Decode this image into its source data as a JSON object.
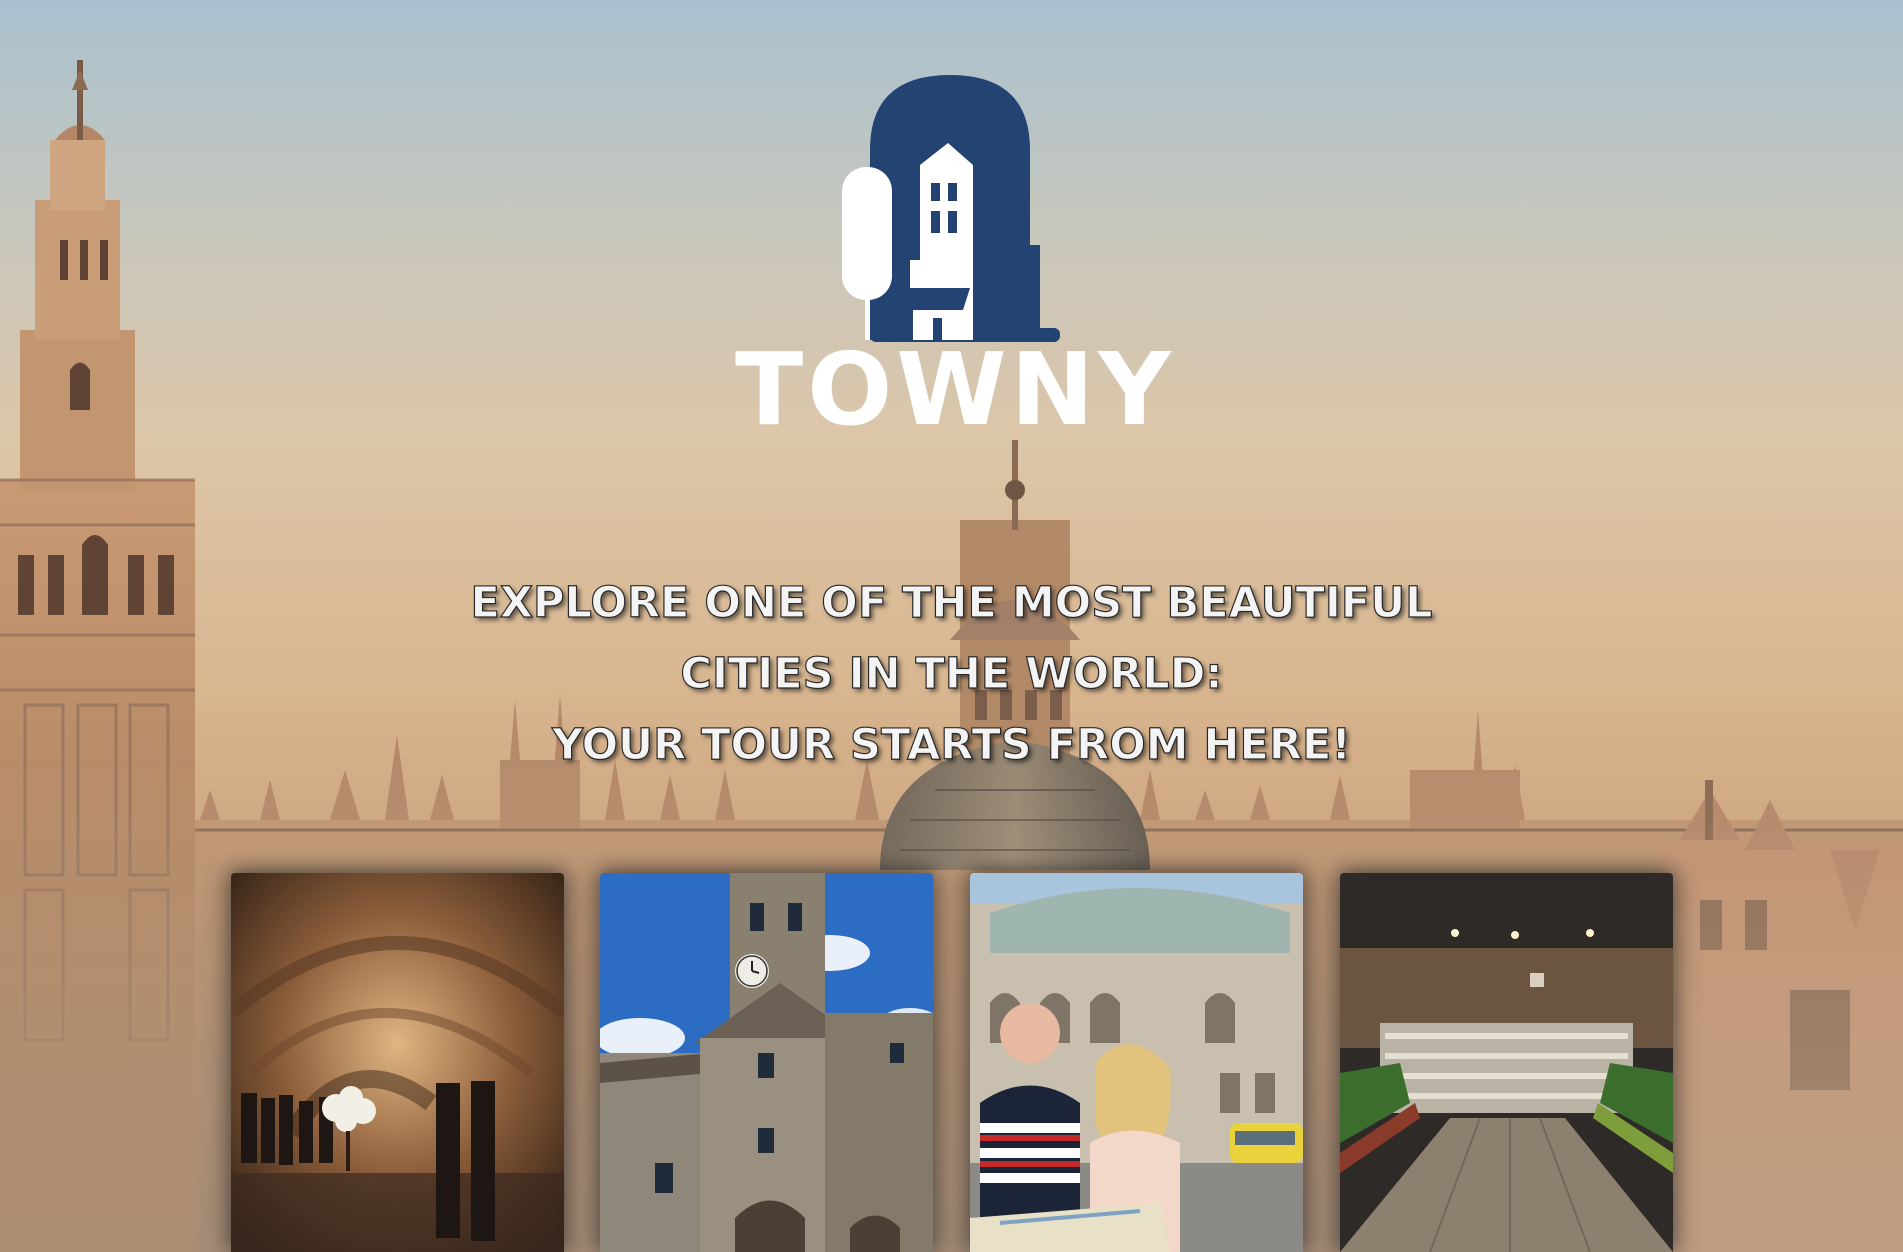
{
  "brand": {
    "name": "TOWNY",
    "primary_color": "#234372",
    "logo_icon": "town-arch-house-tree-icon"
  },
  "hero": {
    "headline_lines": [
      "EXPLORE ONE OF THE MOST BEAUTIFUL",
      "CITIES IN THE WORLD:",
      "YOUR TOUR STARTS FROM HERE!"
    ],
    "background": "city-skyline-cathedral-image"
  },
  "cards": [
    {
      "image": "wine-cellar-event-image"
    },
    {
      "image": "stone-clock-tower-image"
    },
    {
      "image": "tourists-with-map-image"
    },
    {
      "image": "supermarket-interior-image"
    }
  ]
}
